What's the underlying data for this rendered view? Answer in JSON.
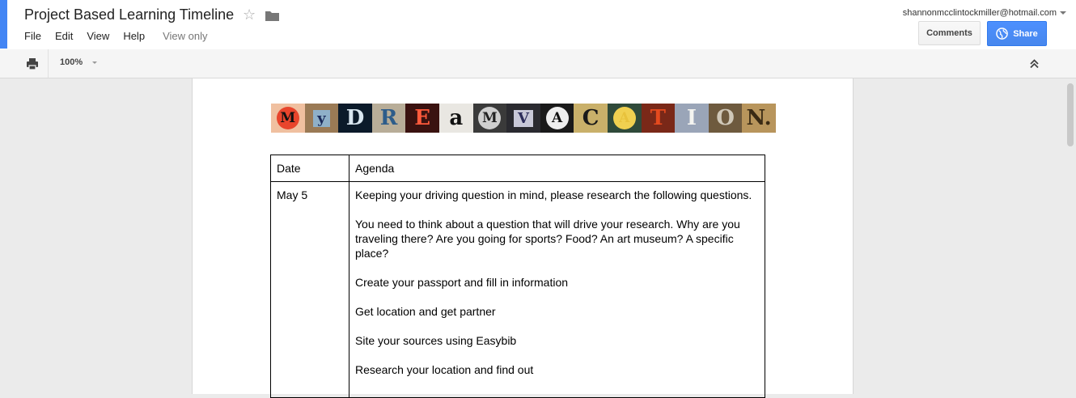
{
  "header": {
    "title": "Project Based Learning Timeline",
    "menu": [
      "File",
      "Edit",
      "View",
      "Help"
    ],
    "view_only": "View only",
    "account": "shannonmcclintockmiller@hotmail.com",
    "comments_label": "Comments",
    "share_label": "Share"
  },
  "toolbar": {
    "zoom": "100%"
  },
  "icons": [
    "star-icon",
    "folder-icon",
    "print-icon",
    "globe-icon",
    "collapse-icon",
    "chevron-down-icon"
  ],
  "colors": {
    "accent": "#4285f4",
    "share_button": "#4d90fe"
  },
  "document": {
    "banner_letters": [
      "M",
      "y",
      "D",
      "R",
      "E",
      "a",
      "M",
      "V",
      "A",
      "C",
      "A",
      "T",
      "I",
      "O",
      "N."
    ],
    "table": {
      "headers": [
        "Date",
        "Agenda"
      ],
      "rows": [
        {
          "date": "May 5",
          "paragraphs": [
            "Keeping your driving question in mind, please research the following questions.",
            "You need to think about a question that will drive your research. Why are you traveling there? Are you going for sports? Food? An art museum? A specific place?",
            "Create your passport and fill in information",
            "Get location and get partner",
            "Site your sources using Easybib",
            "Research your location and find out"
          ]
        }
      ]
    }
  }
}
